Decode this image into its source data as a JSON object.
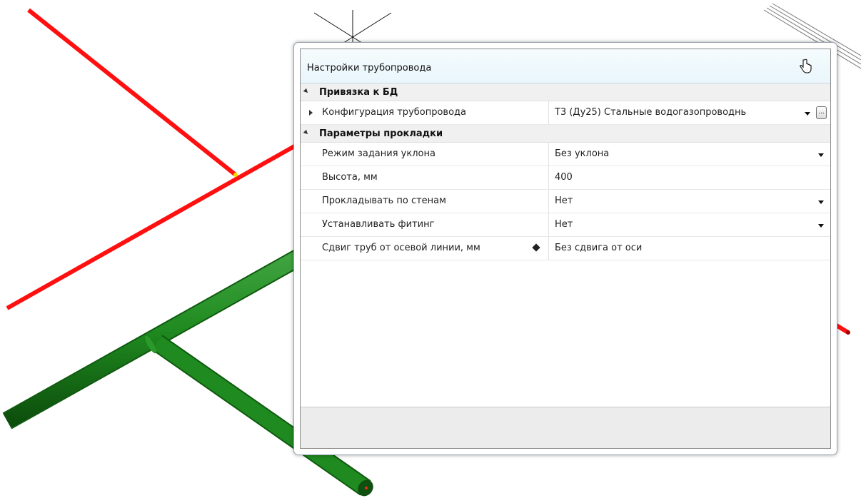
{
  "panel": {
    "title": "Настройки трубопровода"
  },
  "groups": [
    {
      "title": "Привязка к БД",
      "rows": [
        {
          "name": "Конфигурация трубопровода",
          "value": "Т3 (Ду25) Стальные водогазопроводнь"
        }
      ]
    },
    {
      "title": "Параметры прокладки",
      "rows": [
        {
          "name": "Режим задания уклона",
          "value": "Без уклона"
        },
        {
          "name": "Высота, мм",
          "value": "400"
        },
        {
          "name": "Прокладывать по стенам",
          "value": "Нет"
        },
        {
          "name": "Устанавливать фитинг",
          "value": "Нет"
        },
        {
          "name": "Сдвиг труб от осевой линии, мм",
          "value": "Без сдвига от оси"
        }
      ]
    }
  ],
  "ellipsis_label": "...",
  "colors": {
    "red_pipe": "#ff1a1a",
    "green_pipe": "#1e7d1e",
    "header_bg": "#e9f6fb"
  }
}
